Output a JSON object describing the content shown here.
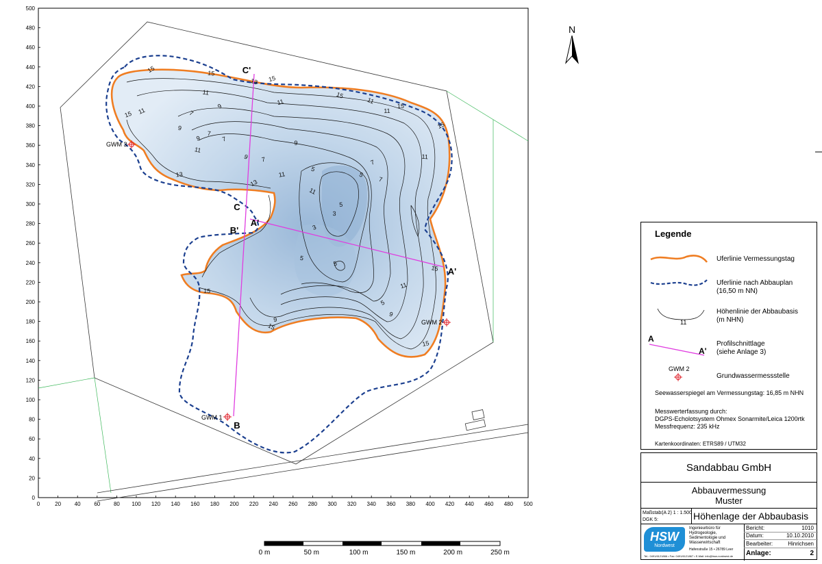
{
  "map": {
    "north_label": "N",
    "y_ticks": [
      "500",
      "480",
      "460",
      "440",
      "420",
      "400",
      "380",
      "360",
      "340",
      "320",
      "300",
      "280",
      "260",
      "240",
      "220",
      "200",
      "180",
      "160",
      "140",
      "120",
      "100",
      "80",
      "60",
      "40",
      "20",
      "0"
    ],
    "x_ticks": [
      "0",
      "20",
      "40",
      "60",
      "80",
      "100",
      "120",
      "140",
      "160",
      "180",
      "200",
      "220",
      "240",
      "260",
      "280",
      "300",
      "320",
      "340",
      "360",
      "380",
      "400",
      "420",
      "440",
      "460",
      "480",
      "500"
    ],
    "contour_labels": [
      "15",
      "15",
      "15",
      "15",
      "15",
      "15",
      "15",
      "15",
      "15",
      "15",
      "15",
      "13",
      "13",
      "13",
      "11",
      "11",
      "11",
      "11",
      "11",
      "11",
      "11",
      "11",
      "11",
      "11",
      "9",
      "9",
      "9",
      "9",
      "9",
      "9",
      "9",
      "7",
      "7",
      "7",
      "7",
      "7",
      "7",
      "5",
      "5",
      "5",
      "5",
      "5",
      "5",
      "3",
      "3"
    ],
    "section_labels": [
      "C'",
      "C",
      "A'",
      "A'",
      "B'",
      "B"
    ],
    "wells": [
      "GWM 3",
      "GWM 2",
      "GWM 1"
    ],
    "scale": {
      "ticks": [
        "0 m",
        "50 m",
        "100 m",
        "150 m",
        "200 m",
        "250 m"
      ]
    }
  },
  "legend": {
    "title": "Legende",
    "items": [
      {
        "label": "Uferlinie Vermessungstag",
        "sub": ""
      },
      {
        "label": "Uferlinie nach Abbauplan",
        "sub": "(16,50 m NN)"
      },
      {
        "label": "Höhenlinie der Abbaubasis",
        "sub": "(m NHN)"
      },
      {
        "label": "Profilschnittlage",
        "sub": "(siehe Anlage 3)"
      },
      {
        "label": "Grundwassermessstelle",
        "sub": ""
      }
    ],
    "sample_contour": "11",
    "sample_a": "A",
    "sample_a2": "A'",
    "sample_gwm": "GWM 2",
    "water_level": "Seewasserspiegel am Vermessungstag: 16,85 m NHN",
    "measure_title": "Messwerterfassung durch:",
    "measure_system": "DGPS-Echolotsystem Ohmex Sonarmite/Leica 1200rtk",
    "measure_freq": "Messfrequenz: 235 kHz",
    "coords": "Kartenkoordinaten: ETRS89 / UTM32"
  },
  "titleblock": {
    "company": "Sandabbau GmbH",
    "project_line1": "Abbauvermessung",
    "project_line2": "Muster",
    "scale_label": "Maßstab:",
    "scale_value": "(A 2)   1 : 1.500",
    "dgk_label": "DGK 5:",
    "plan_title": "Höhenlage der Abbaubasis",
    "logo_text": "HSW",
    "logo_sub": "Nordwest",
    "office": "Ingenieurbüro für Hydrogeologie, Sedimentologie und Wasserwirtschaft",
    "address": "Hafenstraße 15 • 26789 Leer",
    "contact": "Tel.: 0491/6121866 • Fax: 0491/6121867 • E-Mail: info@hsw-nordwest.de",
    "bericht_label": "Bericht:",
    "bericht_value": "1010",
    "datum_label": "Datum:",
    "datum_value": "10.10.2010",
    "bearbeiter_label": "Bearbeiter:",
    "bearbeiter_value": "Hinrichsen",
    "anlage_label": "Anlage:",
    "anlage_value": "2"
  },
  "colors": {
    "shoreline": "#ef7d22",
    "planline": "#1b3f8f",
    "section": "#e03ce0",
    "well": "#e0202a",
    "water_deep": "#9ab8d8",
    "water_light": "#dde9f4",
    "green": "#3cb85a"
  }
}
